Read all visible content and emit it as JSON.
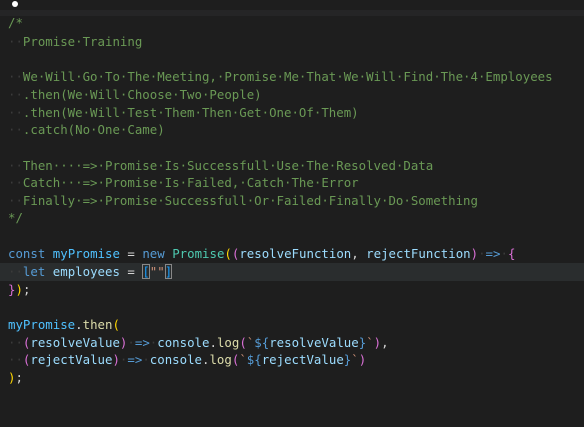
{
  "theme": {
    "background": "#1e1e1e",
    "comment": "#6a9955",
    "keyword": "#569cd6",
    "variable": "#9cdcfe",
    "constant": "#4fc1ff",
    "class": "#4ec9b0",
    "function": "#dcdcaa",
    "string": "#ce9178",
    "bracket_gold": "#ffd700",
    "bracket_orchid": "#da70d6",
    "bracket_blue": "#179fff"
  },
  "code": {
    "comment_open": "/*",
    "comment_title": "Promise·Training",
    "comment_line1": "We·Will·Go·To·The·Meeting,·Promise·Me·That·We·Will·Find·The·4·Employees",
    "comment_line2": ".then(We·Will·Choose·Two·People)",
    "comment_line3": ".then(We·Will·Test·Them·Then·Get·One·Of·Them)",
    "comment_line4": ".catch(No·One·Came)",
    "comment_then": "Then····=>·Promise·Is·Successfull·Use·The·Resolved·Data",
    "comment_catch": "Catch···=>·Promise·Is·Failed,·Catch·The·Error",
    "comment_finally": "Finally·=>·Promise·Successfull·Or·Failed·Finally·Do·Something",
    "comment_close": "*/",
    "kw_const": "const",
    "var_myPromise": "myPromise",
    "op_eq": "=",
    "kw_new": "new",
    "class_Promise": "Promise",
    "param_resolve": "resolveFunction",
    "param_reject": "rejectFunction",
    "arrow": "=>",
    "kw_let": "let",
    "var_employees": "employees",
    "str_empty": "\"\"",
    "close_promise": "});",
    "then_call": "myPromise.then(",
    "param_resolveValue": "resolveValue",
    "param_rejectValue": "rejectValue",
    "console_log": "console.log",
    "close_then": ");"
  }
}
